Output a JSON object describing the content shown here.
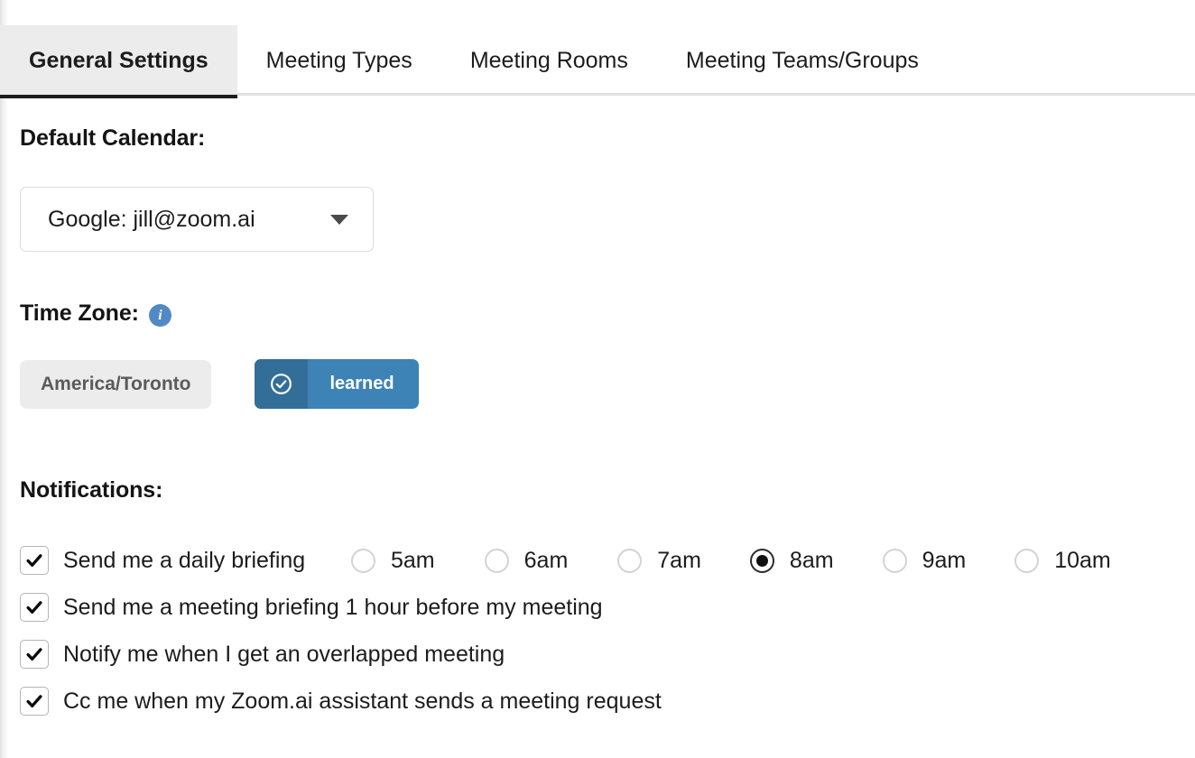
{
  "tabs": [
    {
      "label": "General Settings",
      "active": true
    },
    {
      "label": "Meeting Types",
      "active": false
    },
    {
      "label": "Meeting Rooms",
      "active": false
    },
    {
      "label": "Meeting Teams/Groups",
      "active": false
    }
  ],
  "default_calendar": {
    "heading": "Default Calendar:",
    "selected": "Google: jill@zoom.ai",
    "options": [
      "Google: jill@zoom.ai"
    ]
  },
  "time_zone": {
    "heading": "Time Zone:",
    "info_glyph": "i",
    "value": "America/Toronto",
    "status_label": "learned",
    "status_icon": "check-circle-icon"
  },
  "notifications": {
    "heading": "Notifications:",
    "items": [
      {
        "label": "Send me a daily briefing",
        "checked": true
      },
      {
        "label": "Send me a meeting briefing 1 hour before my meeting",
        "checked": true
      },
      {
        "label": "Notify me when I get an overlapped meeting",
        "checked": true
      },
      {
        "label": "Cc me when my Zoom.ai assistant sends a meeting request",
        "checked": true
      }
    ],
    "briefing_times": [
      {
        "label": "5am",
        "selected": false
      },
      {
        "label": "6am",
        "selected": false
      },
      {
        "label": "7am",
        "selected": false
      },
      {
        "label": "8am",
        "selected": true
      },
      {
        "label": "9am",
        "selected": false
      },
      {
        "label": "10am",
        "selected": false
      }
    ]
  },
  "colors": {
    "accent_blue": "#3d83b5",
    "accent_blue_dark": "#336e99",
    "info_blue": "#5189c4",
    "tab_active_bg": "#ececec",
    "tab_underline": "#1c1c1c",
    "pill_bg": "#ececec",
    "rule": "#e0e0e0"
  }
}
